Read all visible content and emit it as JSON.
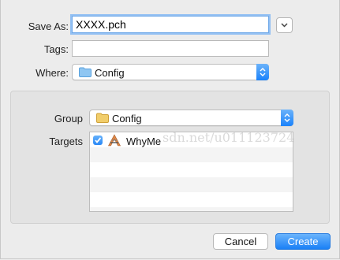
{
  "form": {
    "save_as_label": "Save As:",
    "save_as_value": "XXXX.pch",
    "tags_label": "Tags:",
    "tags_value": "",
    "where_label": "Where:",
    "where_value": "Config"
  },
  "options": {
    "group_label": "Group",
    "group_value": "Config",
    "targets_label": "Targets",
    "targets": [
      {
        "name": "WhyMe",
        "checked": true
      }
    ]
  },
  "buttons": {
    "cancel": "Cancel",
    "create": "Create"
  },
  "watermark": "sdn.net/u011123724",
  "colors": {
    "accent": "#1a82fb",
    "folder": "#e8b84a"
  }
}
